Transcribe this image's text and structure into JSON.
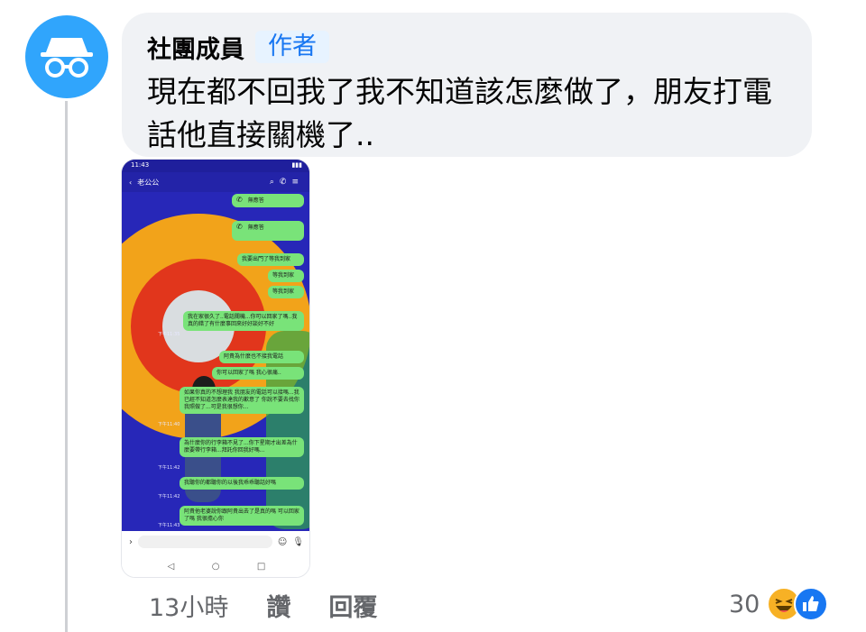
{
  "comment": {
    "author": "社團成員",
    "badge": "作者",
    "text": "現在都不回我了我不知道該怎麼做了，朋友打電話他直接關機了.."
  },
  "phone": {
    "status_time": "11:43",
    "contact_name": "老公公",
    "messages": [
      {
        "text": "無應答",
        "time": "",
        "call": true
      },
      {
        "text": "無應答",
        "time": "",
        "call": true
      },
      {
        "text": "我要出門了等我到家",
        "time": ""
      },
      {
        "text": "等我到家",
        "time": ""
      },
      {
        "text": "等我到家",
        "time": ""
      },
      {
        "text": "我在家很久了..電話關機...你可以回家了嗎..我真的錯了有什麼事回來好好談好不好",
        "time": "下午11:35"
      },
      {
        "text": "阿貴為什麼也不接我電話",
        "time": ""
      },
      {
        "text": "你可以回家了嗎 我心很痛..",
        "time": ""
      },
      {
        "text": "如果你真的不想理我 我朋友的電話可以接嗎...我已經不知道怎麼表達我的歉意了 你說不要去找你我照做了...可是我很想你...",
        "time": "下午11:40"
      },
      {
        "text": "為什麼你的行李箱不見了...你下星期才出差為什麼要帶行李箱...拜託你回我好嗎...",
        "time": "下午11:42"
      },
      {
        "text": "我聽你的都聽你的以後我乖乖聽話好嗎",
        "time": "下午11:42"
      },
      {
        "text": "阿貴他老婆說你跟阿貴出去了是真的嗎 可以回家了嗎 我很擔心你",
        "time": "下午11:43"
      }
    ]
  },
  "actions": {
    "time": "13小時",
    "like": "讚",
    "reply": "回覆"
  },
  "reactions": {
    "count": "30"
  },
  "colors": {
    "avatar_bg": "#30a5fc",
    "bubble_bg": "#f0f2f5",
    "badge_bg": "#e7f3ff",
    "badge_text": "#1877f2"
  }
}
